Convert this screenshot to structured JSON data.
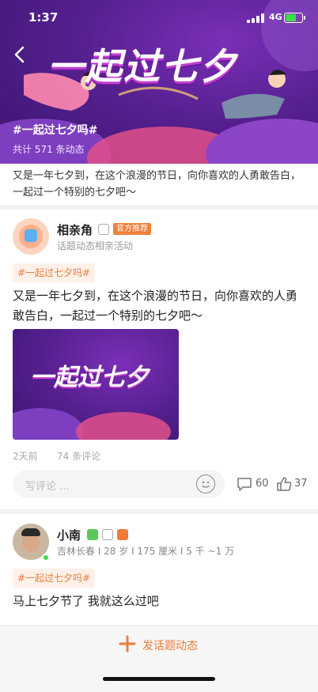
{
  "status_bar": {
    "time": "1:37",
    "network": "4G"
  },
  "hero": {
    "title_art": "一起过七夕",
    "tag": "#一起过七夕吗#",
    "count_text": "共计 571 条动态"
  },
  "topic": {
    "description": "又是一年七夕到，在这个浪漫的节日，向你喜欢的人勇敢告白，一起过一个特别的七夕吧～"
  },
  "post1": {
    "name": "相亲角",
    "official_badge": "官方推荐",
    "subtitle": "话题动态相亲活动",
    "chip": "#一起过七夕吗#",
    "text": "又是一年七夕到，在这个浪漫的节日，向你喜欢的人勇敢告白，一起过一个特别的七夕吧～",
    "image_title": "一起过七夕",
    "time": "2天前",
    "comments_count_text": "74 条评论",
    "comment_placeholder": "写评论 ...",
    "comment_count": "60",
    "like_count": "37"
  },
  "post2": {
    "name": "小南",
    "info": "吉林长春 I 28 岁 I 175 厘米 I 5 千 ~1 万",
    "chip": "#一起过七夕吗#",
    "text": "马上七夕节了  我就这么过吧"
  },
  "bottom": {
    "post_button_label": "发话题动态"
  },
  "colors": {
    "accent": "#f07a3a",
    "hero_purple": "#56208f",
    "online_dot": "#3ddc4a"
  },
  "icons": [
    "back-arrow-icon",
    "signal-icon",
    "battery-icon",
    "verified-icon",
    "emoji-icon",
    "comment-icon",
    "like-icon",
    "plus-icon",
    "chat-badge-icon",
    "level-badge-icon"
  ]
}
